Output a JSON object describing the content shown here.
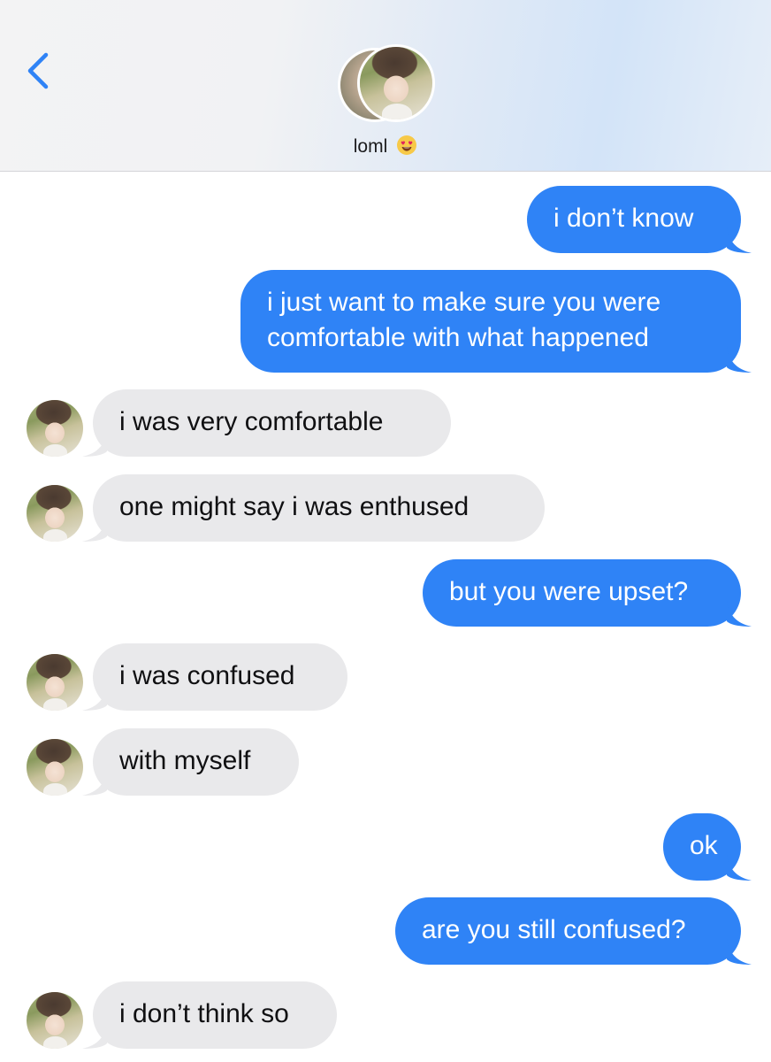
{
  "header": {
    "contact_name": "loml",
    "contact_emoji": "heart-eyes-emoji",
    "accent_color": "#2f83f6"
  },
  "messages": [
    {
      "direction": "outgoing",
      "text": "i don’t know"
    },
    {
      "direction": "outgoing",
      "lines": [
        "i just want to make sure you were",
        "comfortable with what happened"
      ]
    },
    {
      "direction": "incoming",
      "text": "i was very comfortable"
    },
    {
      "direction": "incoming",
      "text": "one might say i was enthused"
    },
    {
      "direction": "outgoing",
      "text": "but you were upset?"
    },
    {
      "direction": "incoming",
      "text": "i was confused"
    },
    {
      "direction": "incoming",
      "text": "with myself"
    },
    {
      "direction": "outgoing",
      "text": "ok"
    },
    {
      "direction": "outgoing",
      "text": "are you still confused?"
    },
    {
      "direction": "incoming",
      "text": "i don’t think so"
    }
  ],
  "colors": {
    "outgoing_bubble": "#2f83f6",
    "incoming_bubble": "#e9e9eb",
    "outgoing_text": "#ffffff",
    "incoming_text": "#101012"
  }
}
